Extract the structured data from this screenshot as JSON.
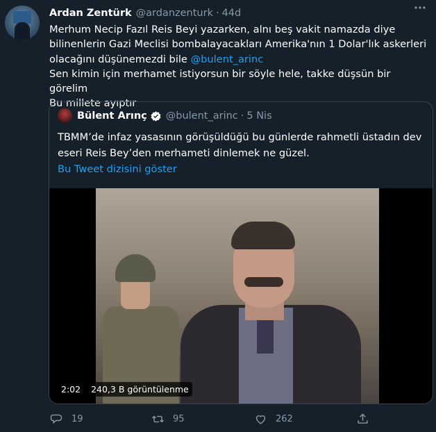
{
  "tweet": {
    "author_name": "Ardan Zentürk",
    "author_handle": "@ardanzenturk",
    "separator": "·",
    "age": "44d",
    "text_lines": [
      "Merhum Necip Fazıl Reis Beyi yazarken, alnı beş vakit namazda diye",
      "bilinenlerin Gazi Meclisi bombalayacakları Amerika'nın 1 Dolar'lık askerleri",
      "olacağını düşünemezdi bile ",
      "Sen kimin için merhamet istiyorsun bir söyle hele, takke düşsün bir görelim",
      "Bu millete ayıptır"
    ],
    "mention": "@bulent_arinc"
  },
  "quoted_tweet": {
    "author_name": "Bülent Arınç",
    "author_handle": "@bulent_arinc",
    "separator": "·",
    "age": "5 Nis",
    "text_lines": [
      "TBMM’de infaz yasasının görüşüldüğü bu günlerde rahmetli üstadın dev",
      "eseri Reis Bey’den merhameti dinlemek ne güzel."
    ],
    "thread_link": "Bu Tweet dizisini göster",
    "video": {
      "duration": "2:02",
      "views": "240,3 B görüntülenme"
    }
  },
  "actions": {
    "reply_count": "19",
    "retweet_count": "95",
    "like_count": "262"
  },
  "colors": {
    "background": "#15202b",
    "link": "#1da1f2",
    "muted": "#8899a6",
    "border": "#38444d"
  }
}
